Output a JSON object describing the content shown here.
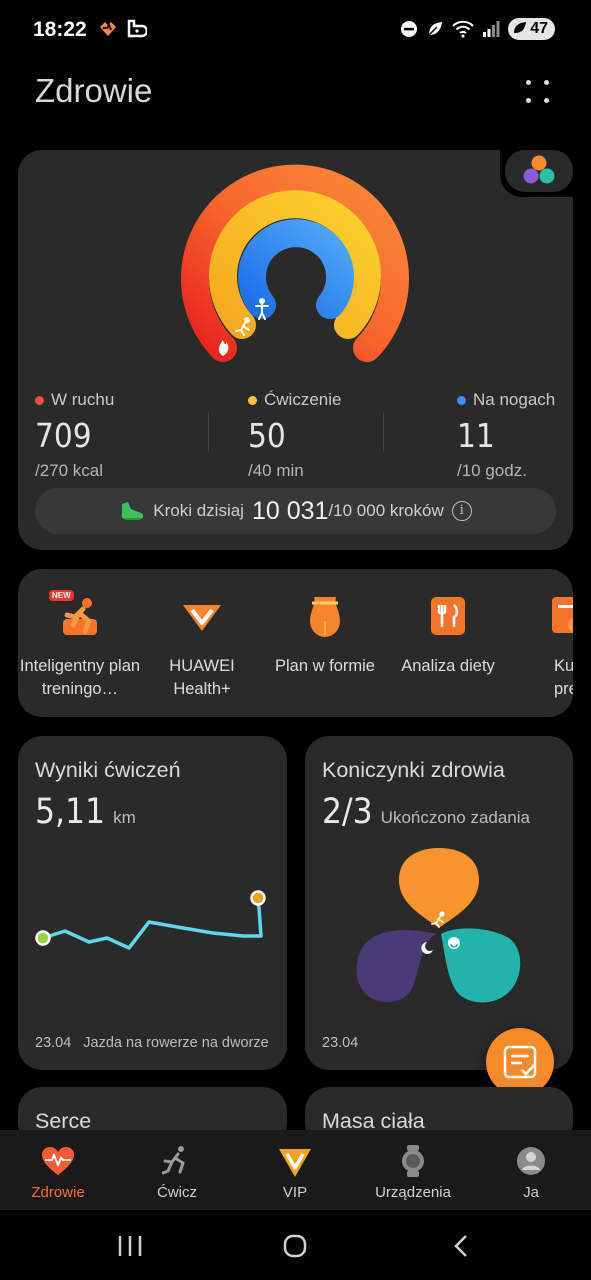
{
  "status_bar": {
    "time": "18:22",
    "battery": "47"
  },
  "header": {
    "title": "Zdrowie"
  },
  "activity": {
    "stats": [
      {
        "label": "W ruchu",
        "value": "709",
        "goal": "/270 kcal",
        "color": "#f24e3a"
      },
      {
        "label": "Ćwiczenie",
        "value": "50",
        "goal": "/40 min",
        "color": "#f7c52b"
      },
      {
        "label": "Na nogach",
        "value": "11",
        "goal": "/10 godz.",
        "color": "#3b8ff5"
      }
    ],
    "steps": {
      "label": "Kroki dzisiaj",
      "value": "10 031",
      "goal": "/10 000 kroków"
    }
  },
  "shortcuts": [
    {
      "label": "Inteligentny plan treningo…",
      "badge": "NEW",
      "icon": "running-plan-icon"
    },
    {
      "label": "HUAWEI Health+",
      "icon": "huawei-vip-icon"
    },
    {
      "label": "Plan w formie",
      "icon": "body-shape-icon"
    },
    {
      "label": "Analiza diety",
      "icon": "diet-analysis-icon"
    },
    {
      "label": "Kurs prem",
      "icon": "course-icon"
    }
  ],
  "workout_card": {
    "title": "Wyniki ćwiczeń",
    "value": "5,11",
    "unit": "km",
    "date": "23.04",
    "activity": "Jazda na rowerze na dworze"
  },
  "clover_card": {
    "title": "Koniczynki zdrowia",
    "value": "2/3",
    "subtitle": "Ukończono zadania",
    "date": "23.04"
  },
  "heart_card": {
    "title": "Serce"
  },
  "weight_card": {
    "title": "Masa ciała"
  },
  "tabs": [
    {
      "label": "Zdrowie",
      "icon": "heart-pulse-icon",
      "active": true
    },
    {
      "label": "Ćwicz",
      "icon": "running-icon"
    },
    {
      "label": "VIP",
      "icon": "vip-icon"
    },
    {
      "label": "Urządzenia",
      "icon": "watch-icon"
    },
    {
      "label": "Ja",
      "icon": "profile-icon"
    }
  ],
  "colors": {
    "accent": "#ff6a3d",
    "move_ring": "#f24e3a",
    "exercise_ring": "#f7c52b",
    "stand_ring": "#3b8ff5"
  }
}
